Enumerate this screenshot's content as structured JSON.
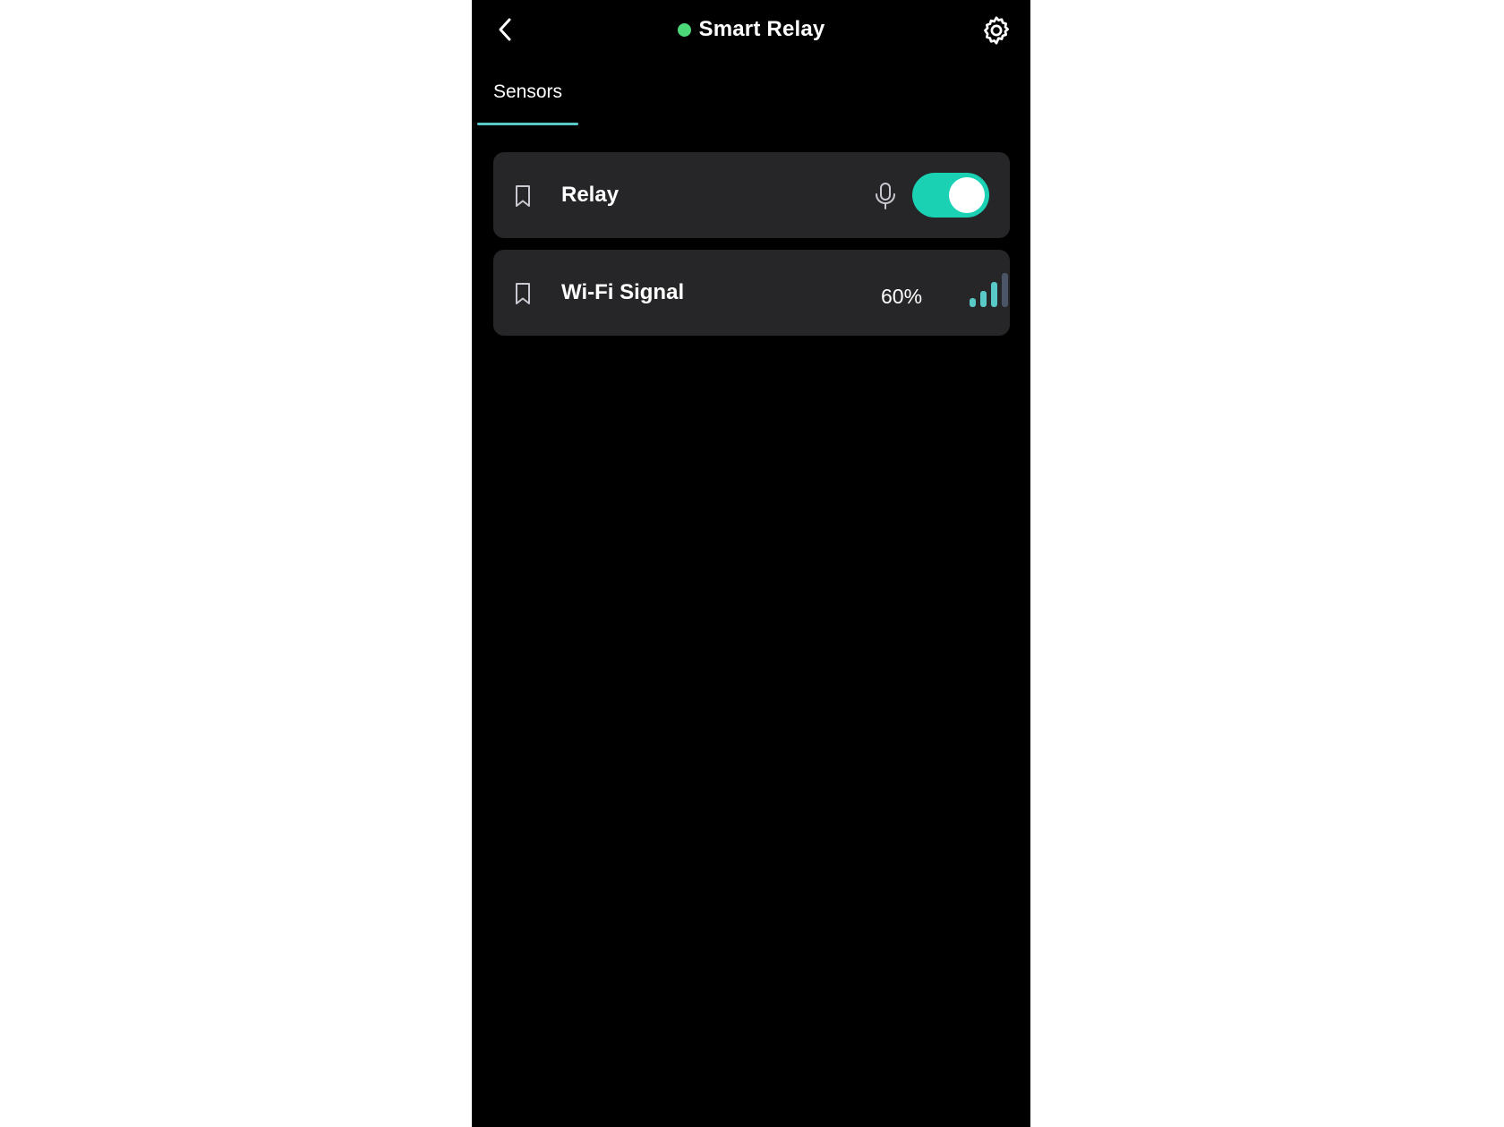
{
  "header": {
    "title": "Smart Relay",
    "status_color": "#4cd97a",
    "back_icon": "chevron-left-icon",
    "settings_icon": "gear-icon"
  },
  "tabs": [
    {
      "label": "Sensors",
      "active": true
    }
  ],
  "sensors": [
    {
      "label": "Relay",
      "bookmark_icon": "bookmark-icon",
      "voice_icon": "microphone-icon",
      "toggle_on": true,
      "toggle_color": "#1bd1b4"
    },
    {
      "label": "Wi-Fi Signal",
      "bookmark_icon": "bookmark-icon",
      "value": "60%",
      "signal_bars_active": 3,
      "signal_bars_total": 4,
      "signal_active_color": "#59c9c8",
      "signal_inactive_color": "#4a5568"
    }
  ]
}
